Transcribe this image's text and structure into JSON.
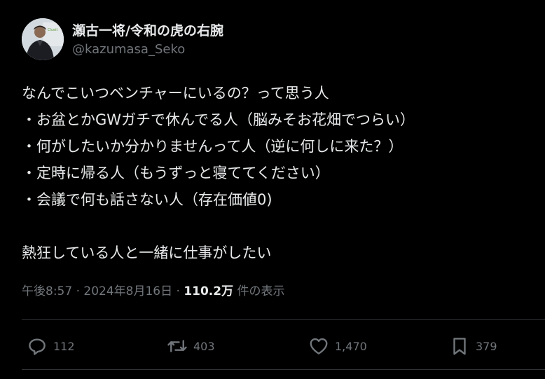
{
  "author": {
    "display_name": "瀬古一将/令和の虎の右腕",
    "handle": "@kazumasa_Seko",
    "avatar_logo_text": "Clueit"
  },
  "tweet": {
    "lines": [
      "なんでこいつベンチャーにいるの？って思う人",
      "・お盆とかGWガチで休んでる人（脳みそお花畑でつらい）",
      "・何がしたいか分かりませんって人（逆に何しに来た？）",
      "・定時に帰る人（もうずっと寝ててください）",
      "・会議で何も話さない人（存在価値0)",
      "",
      "熱狂している人と一緒に仕事がしたい"
    ],
    "timestamp": "午後8:57 · 2024年8月16日 · ",
    "views_count": "110.2万",
    "views_label": " 件の表示"
  },
  "actions": {
    "replies": "112",
    "retweets": "403",
    "likes": "1,470",
    "bookmarks": "379"
  },
  "colors": {
    "background": "#000000",
    "text_primary": "#e7e9ea",
    "text_secondary": "#71767b",
    "divider": "#2f3336"
  }
}
